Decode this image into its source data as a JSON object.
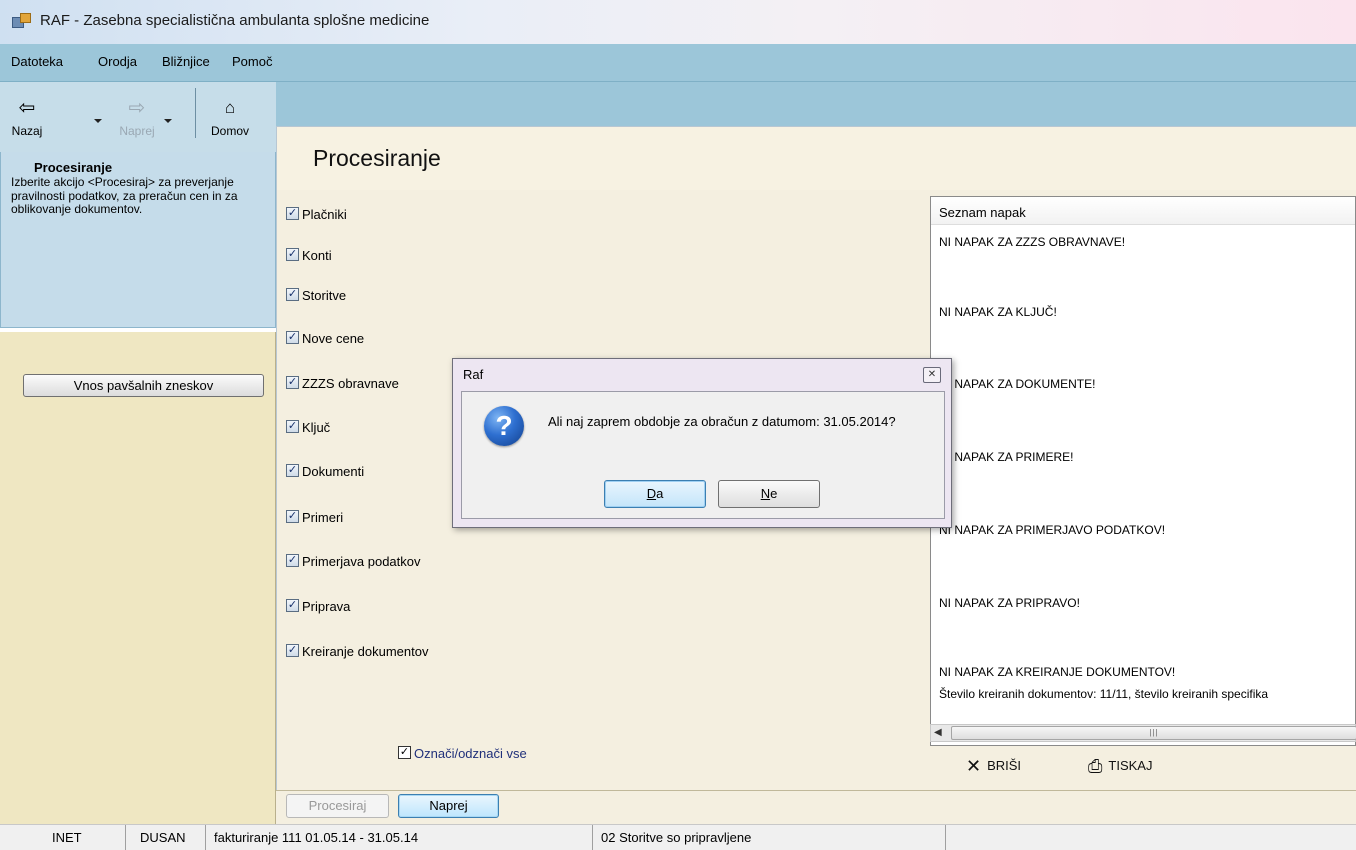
{
  "window": {
    "title": "RAF - Zasebna specialistična ambulanta splošne medicine"
  },
  "menu": {
    "items": [
      "Datoteka",
      "Orodja",
      "Bližnjice",
      "Pomoč"
    ]
  },
  "toolbar": {
    "back_label": "Nazaj",
    "back_icon": "arrow-left-icon",
    "forward_label": "Naprej",
    "forward_icon": "arrow-right-icon",
    "home_label": "Domov",
    "home_icon": "home-icon"
  },
  "left_panel": {
    "title": "Procesiranje",
    "description": "Izberite akcijo <Procesiraj> za preverjanje pravilnosti podatkov, za preračun cen in za oblikovanje dokumentov.",
    "button_label": "Vnos pavšalnih zneskov"
  },
  "main": {
    "title": "Procesiranje",
    "checkboxes": [
      {
        "label": "Plačniki",
        "checked": true
      },
      {
        "label": "Konti",
        "checked": true
      },
      {
        "label": "Storitve",
        "checked": true
      },
      {
        "label": "Nove cene",
        "checked": true
      },
      {
        "label": "ZZZS obravnave",
        "checked": true
      },
      {
        "label": "Ključ",
        "checked": true
      },
      {
        "label": "Dokumenti",
        "checked": true
      },
      {
        "label": "Primeri",
        "checked": true
      },
      {
        "label": "Primerjava podatkov",
        "checked": true
      },
      {
        "label": "Priprava",
        "checked": true
      },
      {
        "label": "Kreiranje dokumentov",
        "checked": true
      }
    ],
    "select_all_label": "Označi/odznači vse",
    "select_all_checked": true,
    "process_button": "Procesiraj",
    "next_button": "Naprej"
  },
  "errors": {
    "header": "Seznam napak",
    "lines": [
      "NI NAPAK ZA ZZZS OBRAVNAVE!",
      "NI NAPAK ZA KLJUČ!",
      "NI NAPAK ZA DOKUMENTE!",
      "NI NAPAK ZA PRIMERE!",
      "NI NAPAK ZA PRIMERJAVO PODATKOV!",
      "NI NAPAK ZA PRIPRAVO!",
      "NI NAPAK ZA KREIRANJE DOKUMENTOV!",
      "Število kreiranih dokumentov: 11/11, število kreiranih specifika"
    ],
    "delete_label": "BRIŠI",
    "print_label": "TISKAJ"
  },
  "dialog": {
    "title": "Raf",
    "message": "Ali naj zaprem obdobje za obračun z datumom: 31.05.2014?",
    "yes": {
      "key": "D",
      "rest": "a"
    },
    "no": {
      "key": "N",
      "rest": "e"
    },
    "icon": "question-icon"
  },
  "status": {
    "cells": [
      "INET",
      "DUSAN",
      "fakturiranje 111  01.05.14 - 31.05.14",
      "02 Storitve so pripravljene"
    ]
  }
}
